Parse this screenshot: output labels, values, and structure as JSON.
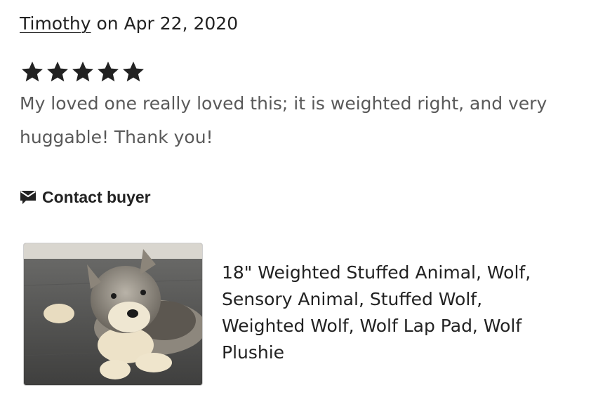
{
  "review": {
    "reviewer_name": "Timothy",
    "date_text": " on Apr 22, 2020",
    "rating": 5,
    "rating_max": 5,
    "text": "My loved one really loved this; it is weighted right, and very huggable! Thank you!",
    "contact_label": "Contact buyer"
  },
  "listing": {
    "title": "18\" Weighted Stuffed Animal, Wolf, Sensory Animal, Stuffed Wolf, Weighted Wolf, Wolf Lap Pad, Wolf Plushie"
  },
  "icons": {
    "star": "star-icon",
    "contact": "envelope-chat-icon"
  },
  "colors": {
    "text_primary": "#222222",
    "text_secondary": "#595959",
    "star": "#222222"
  }
}
